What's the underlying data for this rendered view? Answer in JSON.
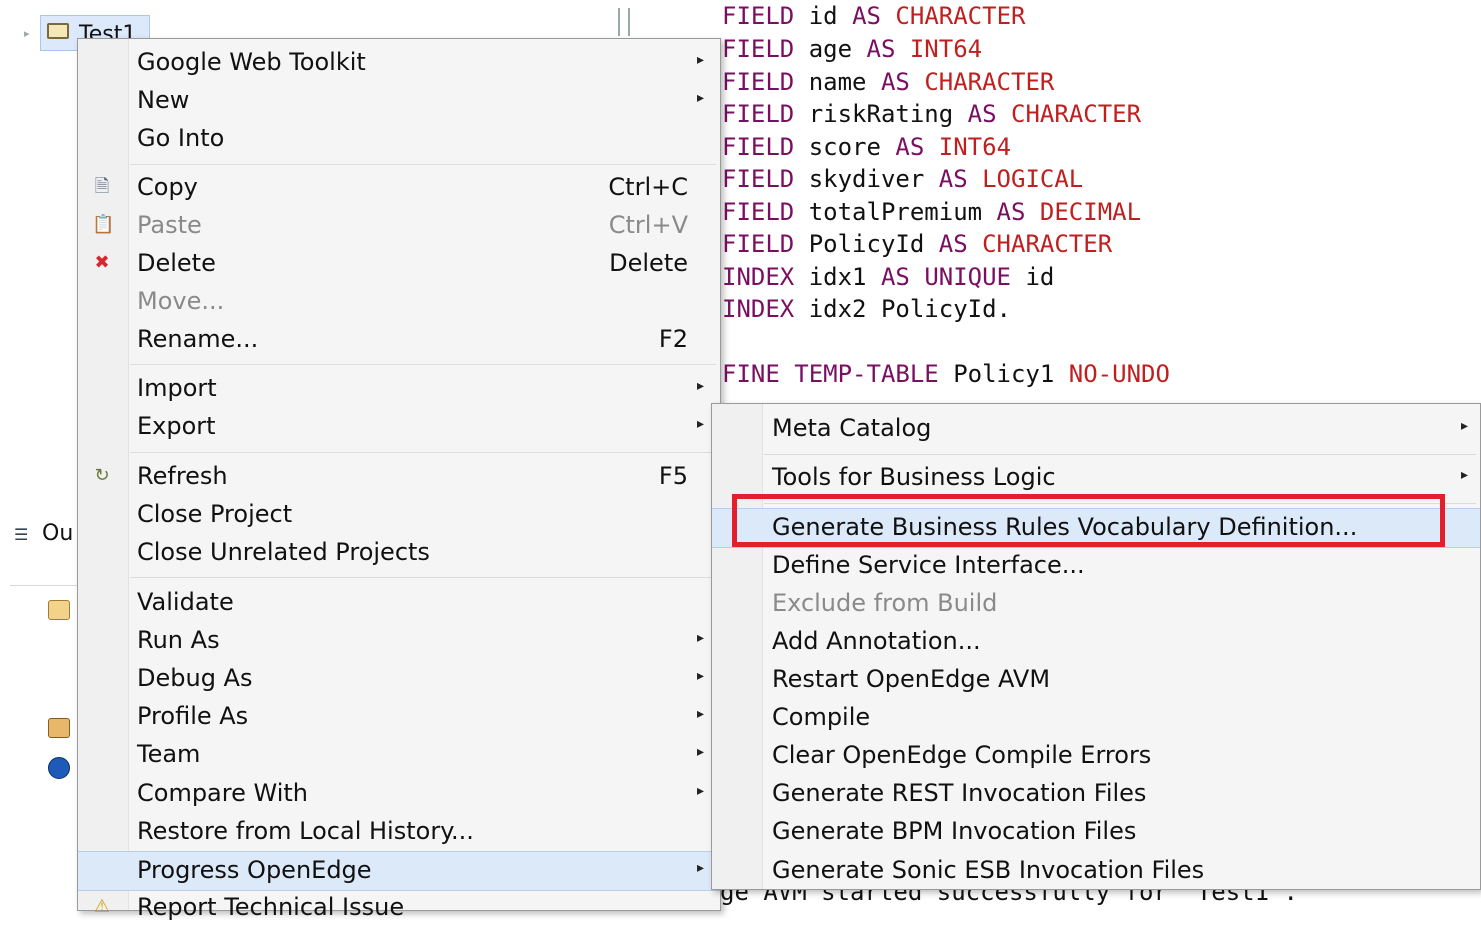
{
  "explorer": {
    "project_name": "Test1",
    "outline_tab_label": "Ou"
  },
  "editor": {
    "code_lines": [
      {
        "parts": [
          [
            "kw",
            "FIELD "
          ],
          [
            "id",
            "id "
          ],
          [
            "kw",
            "AS "
          ],
          [
            "tp",
            "CHARACTER"
          ]
        ]
      },
      {
        "parts": [
          [
            "kw",
            "FIELD "
          ],
          [
            "id",
            "age "
          ],
          [
            "kw",
            "AS "
          ],
          [
            "tp",
            "INT64"
          ]
        ]
      },
      {
        "parts": [
          [
            "kw",
            "FIELD "
          ],
          [
            "id",
            "name "
          ],
          [
            "kw",
            "AS "
          ],
          [
            "tp",
            "CHARACTER"
          ]
        ]
      },
      {
        "parts": [
          [
            "kw",
            "FIELD "
          ],
          [
            "id",
            "riskRating "
          ],
          [
            "kw",
            "AS "
          ],
          [
            "tp",
            "CHARACTER"
          ]
        ]
      },
      {
        "parts": [
          [
            "kw",
            "FIELD "
          ],
          [
            "id",
            "score "
          ],
          [
            "kw",
            "AS "
          ],
          [
            "tp",
            "INT64"
          ]
        ]
      },
      {
        "parts": [
          [
            "kw",
            "FIELD "
          ],
          [
            "id",
            "skydiver "
          ],
          [
            "kw",
            "AS "
          ],
          [
            "tp",
            "LOGICAL"
          ]
        ]
      },
      {
        "parts": [
          [
            "kw",
            "FIELD "
          ],
          [
            "id",
            "totalPremium "
          ],
          [
            "kw",
            "AS "
          ],
          [
            "tp",
            "DECIMAL"
          ]
        ]
      },
      {
        "parts": [
          [
            "kw",
            "FIELD "
          ],
          [
            "id",
            "PolicyId "
          ],
          [
            "kw",
            "AS "
          ],
          [
            "tp",
            "CHARACTER"
          ]
        ]
      },
      {
        "parts": [
          [
            "kw",
            "INDEX "
          ],
          [
            "id",
            "idx1 "
          ],
          [
            "kw",
            "AS "
          ],
          [
            "kw",
            "UNIQUE "
          ],
          [
            "id",
            "id"
          ]
        ]
      },
      {
        "parts": [
          [
            "kw",
            "INDEX "
          ],
          [
            "id",
            "idx2 PolicyId."
          ]
        ]
      }
    ],
    "define_line": [
      [
        "kw",
        "FINE TEMP-TABLE "
      ],
      [
        "id",
        "Policy1 "
      ],
      [
        "tp",
        "NO-UNDO"
      ]
    ],
    "console_text": "ge AVM started successfully for  Test1 ."
  },
  "context_menu": {
    "items": [
      {
        "label": "Google Web Toolkit",
        "submenu": true
      },
      {
        "label": "New",
        "submenu": true
      },
      {
        "label": "Go Into"
      },
      {
        "label": "Copy",
        "accel": "Ctrl+C",
        "icon": "copy-icon"
      },
      {
        "label": "Paste",
        "accel": "Ctrl+V",
        "icon": "paste-icon",
        "disabled": true
      },
      {
        "label": "Delete",
        "accel": "Delete",
        "icon": "delete-icon"
      },
      {
        "label": "Move...",
        "disabled": true
      },
      {
        "label": "Rename...",
        "accel": "F2"
      },
      {
        "label": "Import",
        "submenu": true
      },
      {
        "label": "Export",
        "submenu": true
      },
      {
        "label": "Refresh",
        "accel": "F5",
        "icon": "refresh-icon"
      },
      {
        "label": "Close Project"
      },
      {
        "label": "Close Unrelated Projects"
      },
      {
        "label": "Validate"
      },
      {
        "label": "Run As",
        "submenu": true
      },
      {
        "label": "Debug As",
        "submenu": true
      },
      {
        "label": "Profile As",
        "submenu": true
      },
      {
        "label": "Team",
        "submenu": true
      },
      {
        "label": "Compare With",
        "submenu": true
      },
      {
        "label": "Restore from Local History..."
      },
      {
        "label": "Progress OpenEdge",
        "submenu": true,
        "selected": true
      },
      {
        "label": "Report Technical Issue",
        "icon": "report-icon"
      }
    ]
  },
  "submenu": {
    "items": [
      {
        "label": "Meta Catalog",
        "submenu": true
      },
      {
        "label": "Tools for Business Logic",
        "submenu": true
      },
      {
        "label": "Generate Business Rules Vocabulary Definition...",
        "selected": true
      },
      {
        "label": "Define Service Interface..."
      },
      {
        "label": "Exclude from Build",
        "disabled": true
      },
      {
        "label": "Add Annotation..."
      },
      {
        "label": "Restart OpenEdge AVM"
      },
      {
        "label": "Compile"
      },
      {
        "label": "Clear OpenEdge Compile Errors"
      },
      {
        "label": "Generate REST Invocation Files"
      },
      {
        "label": "Generate BPM Invocation Files"
      },
      {
        "label": "Generate Sonic ESB Invocation Files"
      }
    ]
  },
  "colors": {
    "highlight_box": "#e21f2b",
    "keyword": "#7a0f62",
    "type": "#c01f1f",
    "selection": "#dce9f8"
  }
}
